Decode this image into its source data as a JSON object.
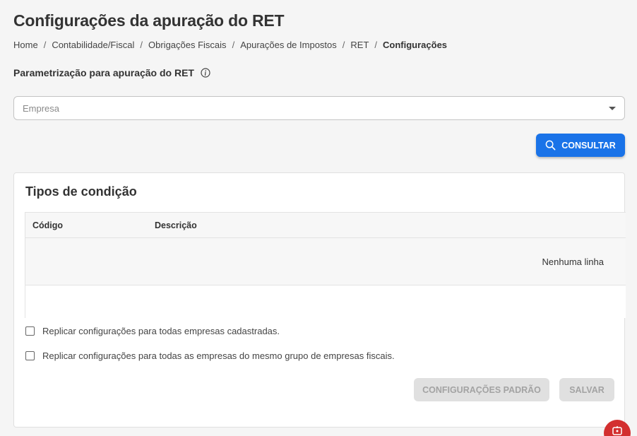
{
  "header": {
    "title": "Configurações da apuração do RET",
    "breadcrumb": [
      "Home",
      "Contabilidade/Fiscal",
      "Obrigações Fiscais",
      "Apurações de Impostos",
      "RET"
    ],
    "breadcrumb_current": "Configurações",
    "breadcrumb_separator": "/"
  },
  "form": {
    "section_label": "Parametrização para apuração do RET",
    "info_icon": "info-icon",
    "empresa_placeholder": "Empresa",
    "consultar_label": "CONSULTAR",
    "consultar_icon": "search-icon"
  },
  "card": {
    "title": "Tipos de condição",
    "columns": [
      "Código",
      "Descrição"
    ],
    "empty_message": "Nenhuma linha",
    "checkboxes": [
      {
        "label": "Replicar configurações para todas empresas cadastradas.",
        "checked": false
      },
      {
        "label": "Replicar configurações para todas as empresas do mesmo grupo de empresas fiscais.",
        "checked": false
      }
    ],
    "buttons": {
      "padrao_label": "CONFIGURAÇÕES PADRÃO",
      "salvar_label": "SALVAR"
    }
  },
  "colors": {
    "primary": "#1a73e8",
    "disabled_bg": "#e0e0e0",
    "disabled_text": "#a3a3a3",
    "fab": "#d32f2f"
  },
  "fab": {
    "icon": "chat-icon"
  }
}
